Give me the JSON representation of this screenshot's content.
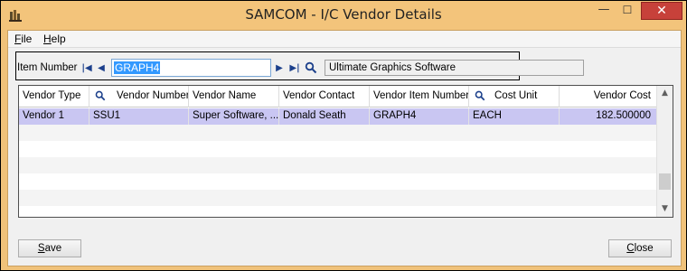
{
  "window": {
    "title": "SAMCOM - I/C Vendor Details",
    "minimize_glyph": "—",
    "maximize_glyph": "☐",
    "close_glyph": "✕"
  },
  "menu": {
    "file": {
      "accel": "F",
      "rest": "ile"
    },
    "help": {
      "accel": "H",
      "rest": "elp"
    }
  },
  "toolbar": {
    "item_number_label": "Item Number",
    "item_number_value": "GRAPH4",
    "item_description": "Ultimate Graphics Software",
    "icons": [
      "first-record-icon",
      "previous-record-icon",
      "next-record-icon",
      "last-record-icon",
      "search-icon"
    ]
  },
  "grid": {
    "columns": [
      "Vendor Type",
      "Vendor Number",
      "Vendor Name",
      "Vendor Contact",
      "Vendor Item Number",
      "Cost Unit",
      "Vendor Cost"
    ],
    "rows": [
      [
        "Vendor 1",
        "SSU1",
        "Super Software, ...",
        "Donald Seath",
        "GRAPH4",
        "EACH",
        "182.500000"
      ]
    ],
    "scroll_up_glyph": "▲",
    "scroll_down_glyph": "▼"
  },
  "buttons": {
    "save": {
      "accel": "S",
      "rest": "ave"
    },
    "close": {
      "accel": "C",
      "rest": "lose"
    }
  },
  "colors": {
    "title_bar": "#f3c47b",
    "selected_row": "#c9c6f2",
    "close_button": "#c7413a",
    "selection_highlight": "#3399ff"
  }
}
